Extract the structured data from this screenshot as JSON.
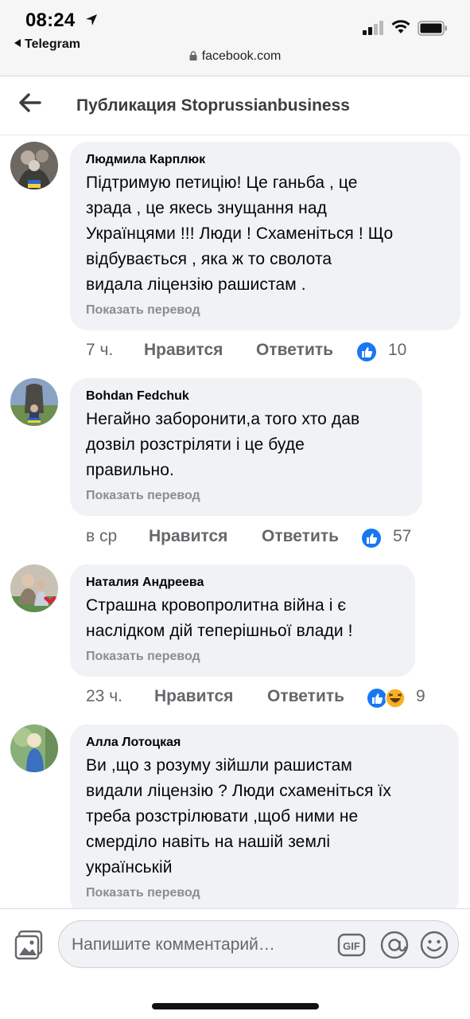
{
  "status_bar": {
    "time": "08:24",
    "back_app": "Telegram",
    "url": "facebook.com"
  },
  "header": {
    "title": "Публикация Stoprussianbusiness",
    "back_icon": "arrow-left-icon"
  },
  "colors": {
    "bubble": "#f0f2f5",
    "like_blue": "#1877f2",
    "meta_gray": "#65676b",
    "translate_gray": "#8a8d91"
  },
  "comments": [
    {
      "author": "Людмила Карплюк",
      "lines": [
        "Підтримую петицію! Це ганьба , це",
        "зрада , це якесь знущання над",
        "Українцями !!! Люди ! Схаменіться ! Що",
        "відбувається , яка ж то сволота",
        "видала ліцензію рашистам ."
      ],
      "translate": "Показать перевод",
      "time": "7 ч.",
      "like": "Нравится",
      "reply": "Ответить",
      "reactions": [
        "like"
      ],
      "count": "10"
    },
    {
      "author": "Bohdan Fedchuk",
      "lines": [
        "Негайно заборонити,а того хто дав",
        "дозвіл розстріляти і це  буде",
        "правильно."
      ],
      "translate": "Показать перевод",
      "time": "в ср",
      "like": "Нравится",
      "reply": "Ответить",
      "reactions": [
        "like"
      ],
      "count": "57"
    },
    {
      "author": "Наталия Андреева",
      "lines": [
        "Страшна кровопролитна війна і є",
        "наслідком дій теперішньої влади !"
      ],
      "translate": "Показать перевод",
      "time": "23 ч.",
      "like": "Нравится",
      "reply": "Ответить",
      "reactions": [
        "like",
        "haha"
      ],
      "count": "9"
    },
    {
      "author": "Алла Лотоцкая",
      "lines": [
        "Ви ,що  з розуму зійшли рашистам",
        "видали ліцензію ? Люди схаменіться їх",
        "треба розстрілювати ,щоб ними не",
        "смерділо навіть на нашій землі",
        "українській"
      ],
      "translate": "Показать перевод"
    }
  ],
  "composer": {
    "placeholder": "Напишите комментарий…",
    "photo_icon": "photo-icon",
    "gif_icon": "gif-icon",
    "at_icon": "at-sign-icon",
    "emoji_icon": "smiley-icon"
  }
}
